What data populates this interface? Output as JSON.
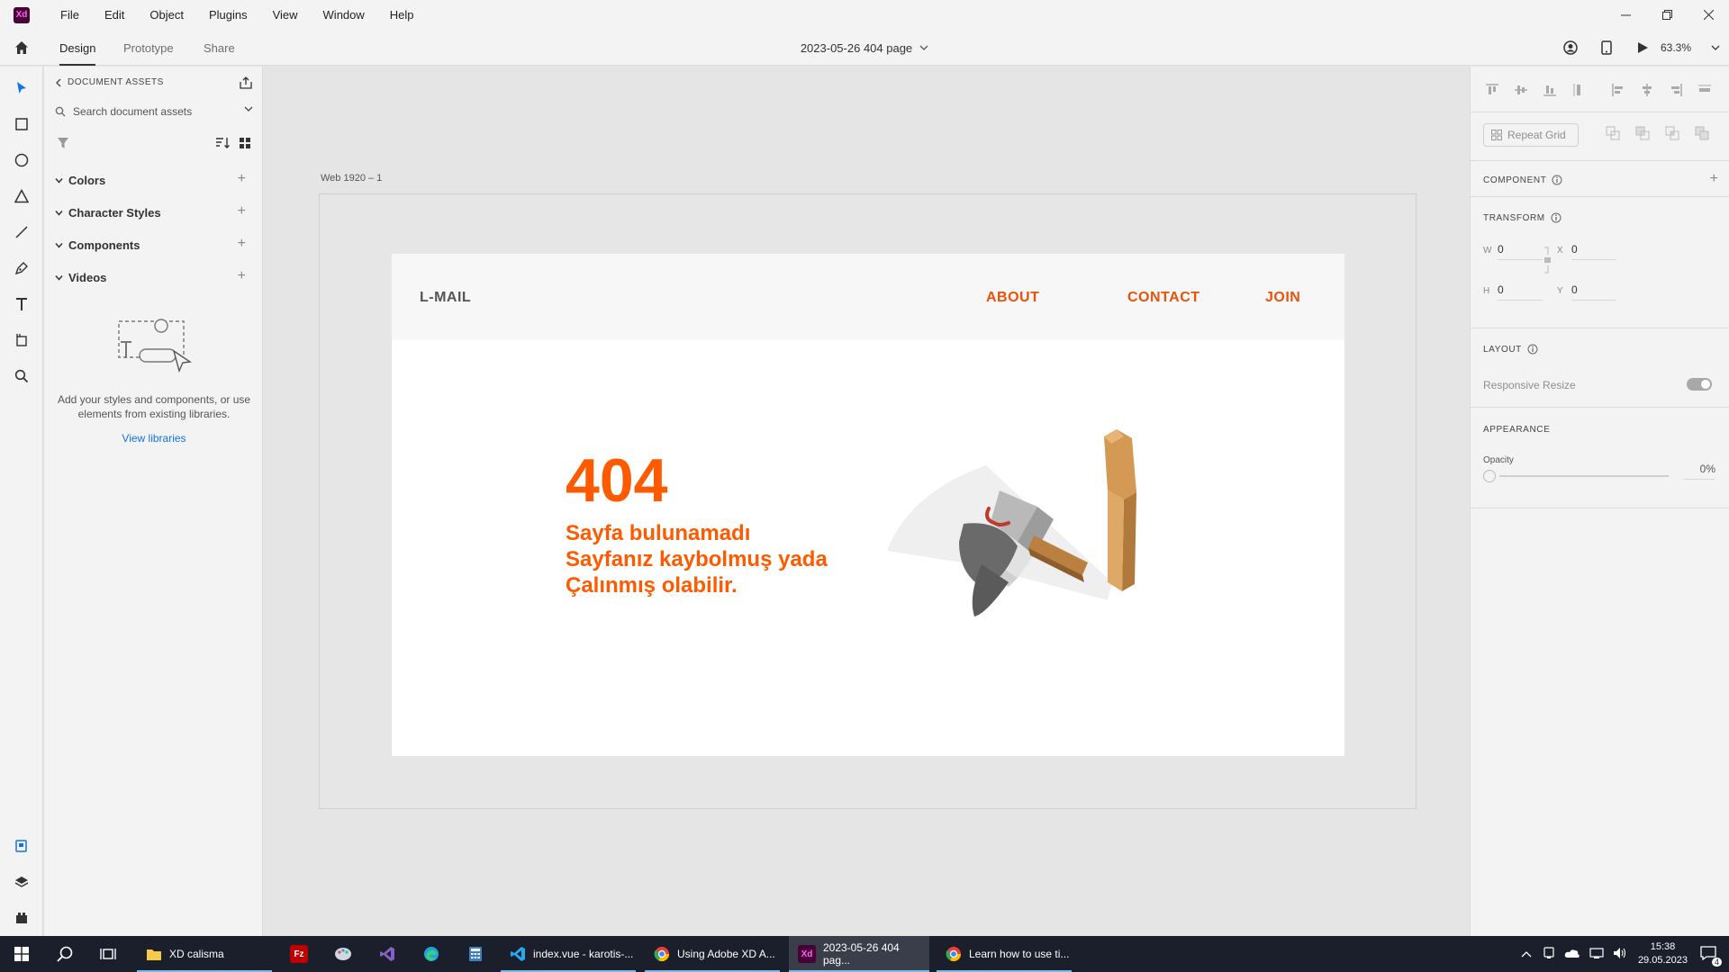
{
  "app": {
    "logo": "Xd"
  },
  "menu": [
    "File",
    "Edit",
    "Object",
    "Plugins",
    "View",
    "Window",
    "Help"
  ],
  "modes": {
    "design": "Design",
    "prototype": "Prototype",
    "share": "Share"
  },
  "document": {
    "title": "2023-05-26 404 page"
  },
  "zoom": "63.3%",
  "assets": {
    "header": "DOCUMENT ASSETS",
    "search_placeholder": "Search document assets",
    "sections": [
      "Colors",
      "Character Styles",
      "Components",
      "Videos"
    ],
    "empty_text": "Add your styles and components, or use elements from existing libraries.",
    "view_libraries": "View libraries"
  },
  "artboard": {
    "label": "Web 1920 – 1",
    "brand": "L-MAIL",
    "nav": [
      "ABOUT",
      "CONTACT",
      "JOIN"
    ],
    "error_code": "404",
    "message_lines": [
      "Sayfa bulunamadı",
      "Sayfanız kaybolmuş yada",
      "Çalınmış olabilir."
    ]
  },
  "properties": {
    "repeat_grid": "Repeat Grid",
    "component": "COMPONENT",
    "transform": "TRANSFORM",
    "w_label": "W",
    "w": "0",
    "x_label": "X",
    "x": "0",
    "h_label": "H",
    "h": "0",
    "y_label": "Y",
    "y": "0",
    "layout": "LAYOUT",
    "responsive_resize": "Responsive Resize",
    "appearance": "APPEARANCE",
    "opacity_label": "Opacity",
    "opacity_value": "0%"
  },
  "taskbar": {
    "apps": [
      {
        "label": "XD calisma",
        "icon": "folder-icon",
        "color": "#f7c948"
      },
      {
        "label": "index.vue - karotis-...",
        "icon": "vscode-icon",
        "color": "#23a8f2"
      },
      {
        "label": "Using Adobe XD A...",
        "icon": "chrome-icon",
        "color": "#e94235"
      },
      {
        "label": "2023-05-26 404 pag...",
        "icon": "xd-icon",
        "color": "#470137"
      },
      {
        "label": "Learn how to use ti...",
        "icon": "chrome-icon",
        "color": "#e94235"
      }
    ],
    "time": "15:38",
    "date": "29.05.2023",
    "notifications": "4"
  },
  "colors": {
    "accent": "#ff5a00",
    "nav_link": "#e8520b",
    "taskbar": "#1b1e2b"
  }
}
